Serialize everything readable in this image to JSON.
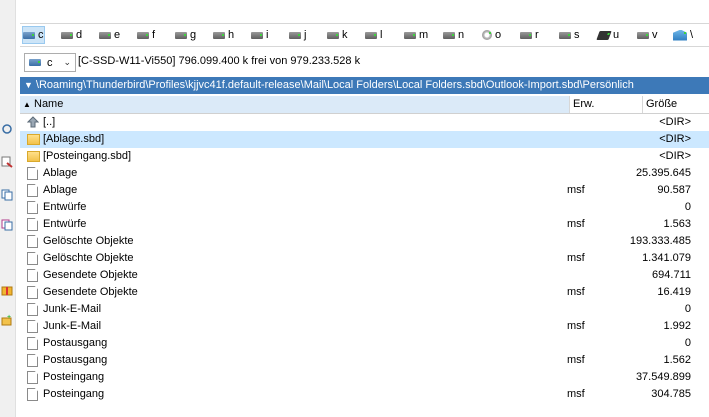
{
  "drives": [
    {
      "letter": "c",
      "type": "sys",
      "active": true
    },
    {
      "letter": "d",
      "type": "hdd"
    },
    {
      "letter": "e",
      "type": "hdd"
    },
    {
      "letter": "f",
      "type": "hdd"
    },
    {
      "letter": "g",
      "type": "hdd"
    },
    {
      "letter": "h",
      "type": "hdd"
    },
    {
      "letter": "i",
      "type": "hdd"
    },
    {
      "letter": "j",
      "type": "hdd"
    },
    {
      "letter": "k",
      "type": "hdd"
    },
    {
      "letter": "l",
      "type": "hdd"
    },
    {
      "letter": "m",
      "type": "hdd"
    },
    {
      "letter": "n",
      "type": "hdd"
    },
    {
      "letter": "o",
      "type": "cd"
    },
    {
      "letter": "r",
      "type": "hdd"
    },
    {
      "letter": "s",
      "type": "hdd"
    },
    {
      "letter": "u",
      "type": "usb"
    },
    {
      "letter": "v",
      "type": "hdd"
    },
    {
      "letter": "\\",
      "type": "net"
    }
  ],
  "drive_selector": {
    "value": "c"
  },
  "drive_info": "[C-SSD-W11-Vi550]  796.099.400 k frei von 979.233.528 k",
  "path": "\\Roaming\\Thunderbird\\Profiles\\kjjvc41f.default-release\\Mail\\Local Folders\\Local Folders.sbd\\Outlook-Import.sbd\\Persönlich",
  "columns": {
    "name": "Name",
    "ext": "Erw.",
    "size": "Größe"
  },
  "files": [
    {
      "name": "[..]",
      "ext": "",
      "size": "<DIR>",
      "icon": "up-icon"
    },
    {
      "name": "[Ablage.sbd]",
      "ext": "",
      "size": "<DIR>",
      "icon": "folder-icon",
      "selected": true
    },
    {
      "name": "[Posteingang.sbd]",
      "ext": "",
      "size": "<DIR>",
      "icon": "folder-icon"
    },
    {
      "name": "Ablage",
      "ext": "",
      "size": "25.395.645",
      "icon": "file-icon"
    },
    {
      "name": "Ablage",
      "ext": "msf",
      "size": "90.587",
      "icon": "file-icon"
    },
    {
      "name": "Entwürfe",
      "ext": "",
      "size": "0",
      "icon": "file-icon"
    },
    {
      "name": "Entwürfe",
      "ext": "msf",
      "size": "1.563",
      "icon": "file-icon"
    },
    {
      "name": "Gelöschte Objekte",
      "ext": "",
      "size": "193.333.485",
      "icon": "file-icon"
    },
    {
      "name": "Gelöschte Objekte",
      "ext": "msf",
      "size": "1.341.079",
      "icon": "file-icon"
    },
    {
      "name": "Gesendete Objekte",
      "ext": "",
      "size": "694.711",
      "icon": "file-icon"
    },
    {
      "name": "Gesendete Objekte",
      "ext": "msf",
      "size": "16.419",
      "icon": "file-icon"
    },
    {
      "name": "Junk-E-Mail",
      "ext": "",
      "size": "0",
      "icon": "file-icon"
    },
    {
      "name": "Junk-E-Mail",
      "ext": "msf",
      "size": "1.992",
      "icon": "file-icon"
    },
    {
      "name": "Postausgang",
      "ext": "",
      "size": "0",
      "icon": "file-icon"
    },
    {
      "name": "Postausgang",
      "ext": "msf",
      "size": "1.562",
      "icon": "file-icon"
    },
    {
      "name": "Posteingang",
      "ext": "",
      "size": "37.549.899",
      "icon": "file-icon"
    },
    {
      "name": "Posteingang",
      "ext": "msf",
      "size": "304.785",
      "icon": "file-icon"
    }
  ],
  "colors": {
    "path_bar": "#3d79b8",
    "selection": "#cce8ff",
    "header_active": "#dbeaf8"
  }
}
